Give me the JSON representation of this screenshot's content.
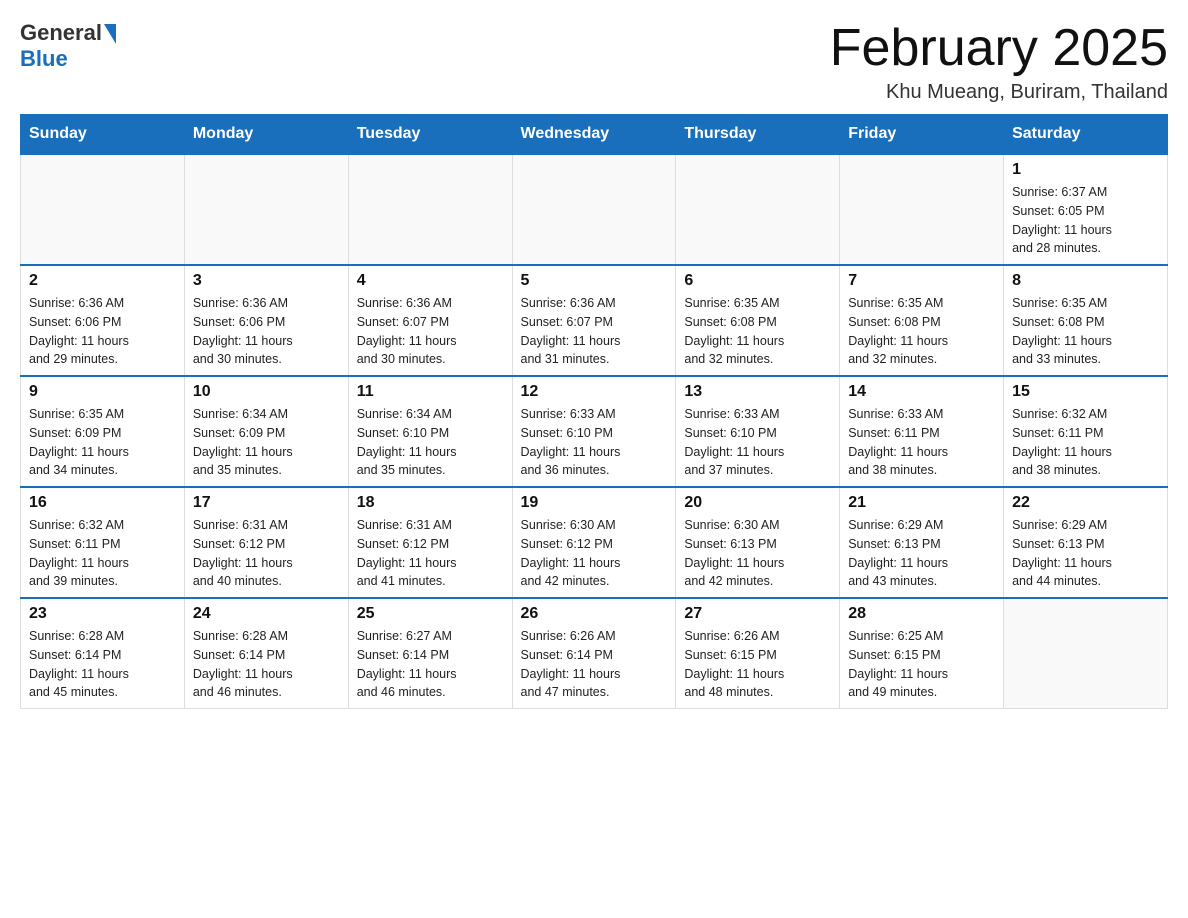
{
  "header": {
    "logo": {
      "general": "General",
      "blue": "Blue"
    },
    "title": "February 2025",
    "location": "Khu Mueang, Buriram, Thailand"
  },
  "days_of_week": [
    "Sunday",
    "Monday",
    "Tuesday",
    "Wednesday",
    "Thursday",
    "Friday",
    "Saturday"
  ],
  "weeks": [
    {
      "days": [
        {
          "number": "",
          "info": ""
        },
        {
          "number": "",
          "info": ""
        },
        {
          "number": "",
          "info": ""
        },
        {
          "number": "",
          "info": ""
        },
        {
          "number": "",
          "info": ""
        },
        {
          "number": "",
          "info": ""
        },
        {
          "number": "1",
          "info": "Sunrise: 6:37 AM\nSunset: 6:05 PM\nDaylight: 11 hours\nand 28 minutes."
        }
      ]
    },
    {
      "days": [
        {
          "number": "2",
          "info": "Sunrise: 6:36 AM\nSunset: 6:06 PM\nDaylight: 11 hours\nand 29 minutes."
        },
        {
          "number": "3",
          "info": "Sunrise: 6:36 AM\nSunset: 6:06 PM\nDaylight: 11 hours\nand 30 minutes."
        },
        {
          "number": "4",
          "info": "Sunrise: 6:36 AM\nSunset: 6:07 PM\nDaylight: 11 hours\nand 30 minutes."
        },
        {
          "number": "5",
          "info": "Sunrise: 6:36 AM\nSunset: 6:07 PM\nDaylight: 11 hours\nand 31 minutes."
        },
        {
          "number": "6",
          "info": "Sunrise: 6:35 AM\nSunset: 6:08 PM\nDaylight: 11 hours\nand 32 minutes."
        },
        {
          "number": "7",
          "info": "Sunrise: 6:35 AM\nSunset: 6:08 PM\nDaylight: 11 hours\nand 32 minutes."
        },
        {
          "number": "8",
          "info": "Sunrise: 6:35 AM\nSunset: 6:08 PM\nDaylight: 11 hours\nand 33 minutes."
        }
      ]
    },
    {
      "days": [
        {
          "number": "9",
          "info": "Sunrise: 6:35 AM\nSunset: 6:09 PM\nDaylight: 11 hours\nand 34 minutes."
        },
        {
          "number": "10",
          "info": "Sunrise: 6:34 AM\nSunset: 6:09 PM\nDaylight: 11 hours\nand 35 minutes."
        },
        {
          "number": "11",
          "info": "Sunrise: 6:34 AM\nSunset: 6:10 PM\nDaylight: 11 hours\nand 35 minutes."
        },
        {
          "number": "12",
          "info": "Sunrise: 6:33 AM\nSunset: 6:10 PM\nDaylight: 11 hours\nand 36 minutes."
        },
        {
          "number": "13",
          "info": "Sunrise: 6:33 AM\nSunset: 6:10 PM\nDaylight: 11 hours\nand 37 minutes."
        },
        {
          "number": "14",
          "info": "Sunrise: 6:33 AM\nSunset: 6:11 PM\nDaylight: 11 hours\nand 38 minutes."
        },
        {
          "number": "15",
          "info": "Sunrise: 6:32 AM\nSunset: 6:11 PM\nDaylight: 11 hours\nand 38 minutes."
        }
      ]
    },
    {
      "days": [
        {
          "number": "16",
          "info": "Sunrise: 6:32 AM\nSunset: 6:11 PM\nDaylight: 11 hours\nand 39 minutes."
        },
        {
          "number": "17",
          "info": "Sunrise: 6:31 AM\nSunset: 6:12 PM\nDaylight: 11 hours\nand 40 minutes."
        },
        {
          "number": "18",
          "info": "Sunrise: 6:31 AM\nSunset: 6:12 PM\nDaylight: 11 hours\nand 41 minutes."
        },
        {
          "number": "19",
          "info": "Sunrise: 6:30 AM\nSunset: 6:12 PM\nDaylight: 11 hours\nand 42 minutes."
        },
        {
          "number": "20",
          "info": "Sunrise: 6:30 AM\nSunset: 6:13 PM\nDaylight: 11 hours\nand 42 minutes."
        },
        {
          "number": "21",
          "info": "Sunrise: 6:29 AM\nSunset: 6:13 PM\nDaylight: 11 hours\nand 43 minutes."
        },
        {
          "number": "22",
          "info": "Sunrise: 6:29 AM\nSunset: 6:13 PM\nDaylight: 11 hours\nand 44 minutes."
        }
      ]
    },
    {
      "days": [
        {
          "number": "23",
          "info": "Sunrise: 6:28 AM\nSunset: 6:14 PM\nDaylight: 11 hours\nand 45 minutes."
        },
        {
          "number": "24",
          "info": "Sunrise: 6:28 AM\nSunset: 6:14 PM\nDaylight: 11 hours\nand 46 minutes."
        },
        {
          "number": "25",
          "info": "Sunrise: 6:27 AM\nSunset: 6:14 PM\nDaylight: 11 hours\nand 46 minutes."
        },
        {
          "number": "26",
          "info": "Sunrise: 6:26 AM\nSunset: 6:14 PM\nDaylight: 11 hours\nand 47 minutes."
        },
        {
          "number": "27",
          "info": "Sunrise: 6:26 AM\nSunset: 6:15 PM\nDaylight: 11 hours\nand 48 minutes."
        },
        {
          "number": "28",
          "info": "Sunrise: 6:25 AM\nSunset: 6:15 PM\nDaylight: 11 hours\nand 49 minutes."
        },
        {
          "number": "",
          "info": ""
        }
      ]
    }
  ]
}
